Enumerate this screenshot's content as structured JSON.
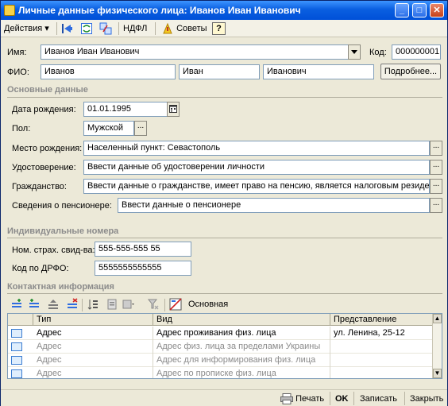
{
  "window": {
    "title": "Личные данные физического лица: Иванов Иван Иванович",
    "min": "_",
    "max": "□",
    "close": "✕"
  },
  "toolbar": {
    "actions_label": "Действия ▾",
    "ndfl_label": "НДФЛ",
    "tips_label": "Советы",
    "help_label": "?"
  },
  "header": {
    "name_label": "Имя:",
    "name_value": "Иванов Иван Иванович",
    "code_label": "Код:",
    "code_value": "000000001",
    "fio_label": "ФИО:",
    "surname": "Иванов",
    "firstname": "Иван",
    "patronymic": "Иванович",
    "more_button": "Подробнее..."
  },
  "basic": {
    "title": "Основные данные",
    "birthdate_label": "Дата рождения:",
    "birthdate_value": "01.01.1995",
    "gender_label": "Пол:",
    "gender_value": "Мужской",
    "birthplace_label": "Место рождения:",
    "birthplace_value": "Населенный пункт: Севастополь",
    "id_label": "Удостоверение:",
    "id_value": "Ввести данные об удостоверении личности",
    "citizenship_label": "Гражданство:",
    "citizenship_value": "Ввести данные о гражданстве, имеет право на пенсию, является налоговым резиде",
    "pensioner_label": "Сведения о пенсионере:",
    "pensioner_value": "Ввести данные о пенсионере",
    "ellipsis": "..."
  },
  "numbers": {
    "title": "Индивидуальные номера",
    "snils_label": "Ном. страх. свид-ва:",
    "snils_value": "555-555-555 55",
    "drfo_label": "Код по ДРФО:",
    "drfo_value": "5555555555555"
  },
  "contacts": {
    "title": "Контактная информация",
    "main_label": "Основная",
    "columns": [
      "Тип",
      "Вид",
      "Представление"
    ],
    "rows": [
      {
        "type": "Адрес",
        "kind": "Адрес проживания физ. лица",
        "repr": "ул. Ленина, 25-12"
      },
      {
        "type": "Адрес",
        "kind": "Адрес физ. лица за пределами Украины",
        "repr": ""
      },
      {
        "type": "Адрес",
        "kind": "Адрес для информирования физ. лица",
        "repr": ""
      },
      {
        "type": "Адрес",
        "kind": "Адрес по прописке физ. лица",
        "repr": ""
      }
    ]
  },
  "footer": {
    "print_label": "Печать",
    "ok_label": "OK",
    "save_label": "Записать",
    "close_label": "Закрыть"
  },
  "colors": {
    "title_bar": "#0A5FE0",
    "window_bg": "#ECE9D8",
    "field_border": "#7f9db9",
    "section_title": "#8b8b8b"
  }
}
